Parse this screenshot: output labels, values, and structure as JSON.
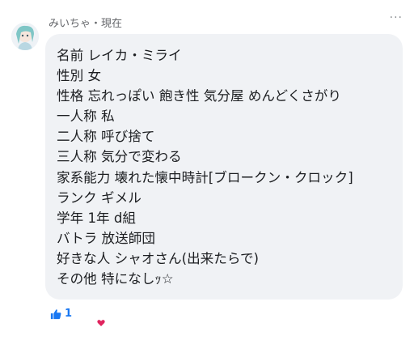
{
  "comment": {
    "author": "みいちゃ",
    "separator": "・",
    "time": "現在",
    "more_label": "···",
    "lines": [
      "名前 レイカ・ミライ",
      "性別 女",
      "性格 忘れっぽい 飽き性 気分屋 めんどくさがり",
      "一人称 私",
      "二人称 呼び捨て",
      "三人称 気分で変わる",
      "家系能力 壊れた懐中時計[ブロークン・クロック]",
      "ランク ギメル",
      "学年 1年 d組",
      "バトラ 放送師団",
      "好きな人 シャオさん(出来たらで)",
      "その他 特になしｯ☆"
    ]
  },
  "reactions": {
    "like_count": "1",
    "like_icon": "thumbs-up-icon",
    "heart_icon": "heart-icon"
  },
  "colors": {
    "bubble": "#f0f2f5",
    "like": "#1877f2",
    "heart": "#e0245e",
    "meta_text": "#65676b"
  }
}
